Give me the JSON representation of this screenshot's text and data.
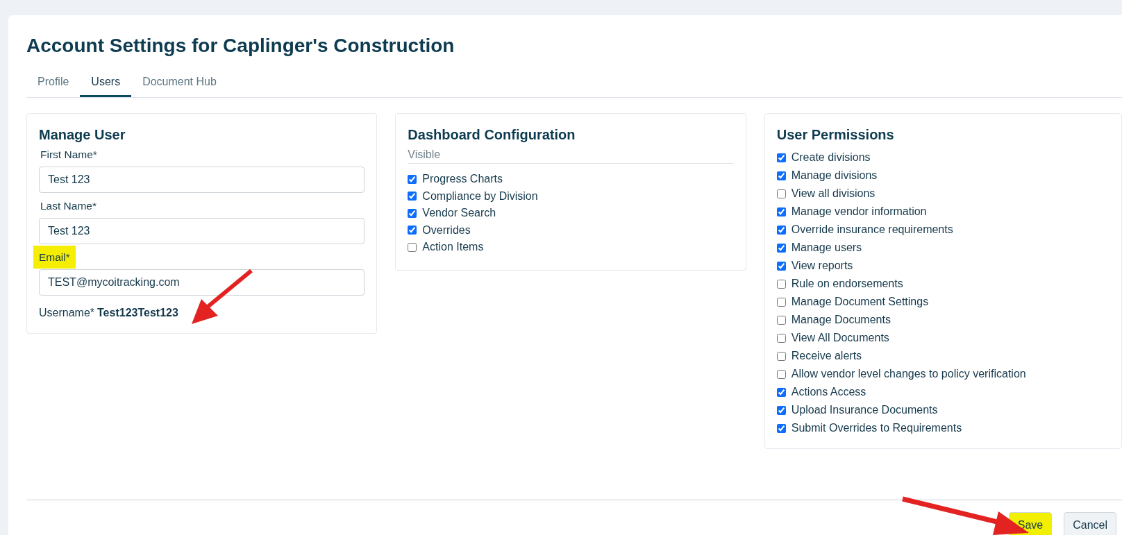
{
  "title": "Account Settings for Caplinger's Construction",
  "tabs": [
    {
      "label": "Profile",
      "selected": false
    },
    {
      "label": "Users",
      "selected": true
    },
    {
      "label": "Document Hub",
      "selected": false
    }
  ],
  "manage_user": {
    "title": "Manage User",
    "fields": [
      {
        "label": "First Name*",
        "value": "Test 123",
        "highlighted": false
      },
      {
        "label": "Last Name*",
        "value": "Test 123",
        "highlighted": false
      },
      {
        "label": "Email*",
        "value": "TEST@mycoitracking.com",
        "highlighted": true
      }
    ],
    "username_label": "Username*",
    "username": "Test123Test123"
  },
  "dashboard": {
    "title": "Dashboard Configuration",
    "subtitle": "Visible",
    "items": [
      {
        "label": "Progress Charts",
        "checked": true
      },
      {
        "label": "Compliance by Division",
        "checked": true
      },
      {
        "label": "Vendor Search",
        "checked": true
      },
      {
        "label": "Overrides",
        "checked": true
      },
      {
        "label": "Action Items",
        "checked": false
      }
    ]
  },
  "permissions": {
    "title": "User Permissions",
    "items": [
      {
        "label": "Create divisions",
        "checked": true
      },
      {
        "label": "Manage divisions",
        "checked": true
      },
      {
        "label": "View all divisions",
        "checked": false
      },
      {
        "label": "Manage vendor information",
        "checked": true
      },
      {
        "label": "Override insurance requirements",
        "checked": true
      },
      {
        "label": "Manage users",
        "checked": true
      },
      {
        "label": "View reports",
        "checked": true
      },
      {
        "label": "Rule on endorsements",
        "checked": false
      },
      {
        "label": "Manage Document Settings",
        "checked": false
      },
      {
        "label": "Manage Documents",
        "checked": false
      },
      {
        "label": "View All Documents",
        "checked": false
      },
      {
        "label": "Receive alerts",
        "checked": false
      },
      {
        "label": "Allow vendor level changes to policy verification",
        "checked": false
      },
      {
        "label": "Actions Access",
        "checked": true
      },
      {
        "label": "Upload Insurance Documents",
        "checked": true
      },
      {
        "label": "Submit Overrides to Requirements",
        "checked": true
      }
    ]
  },
  "buttons": [
    {
      "label": "Save",
      "highlighted": true
    },
    {
      "label": "Cancel",
      "highlighted": false
    }
  ]
}
